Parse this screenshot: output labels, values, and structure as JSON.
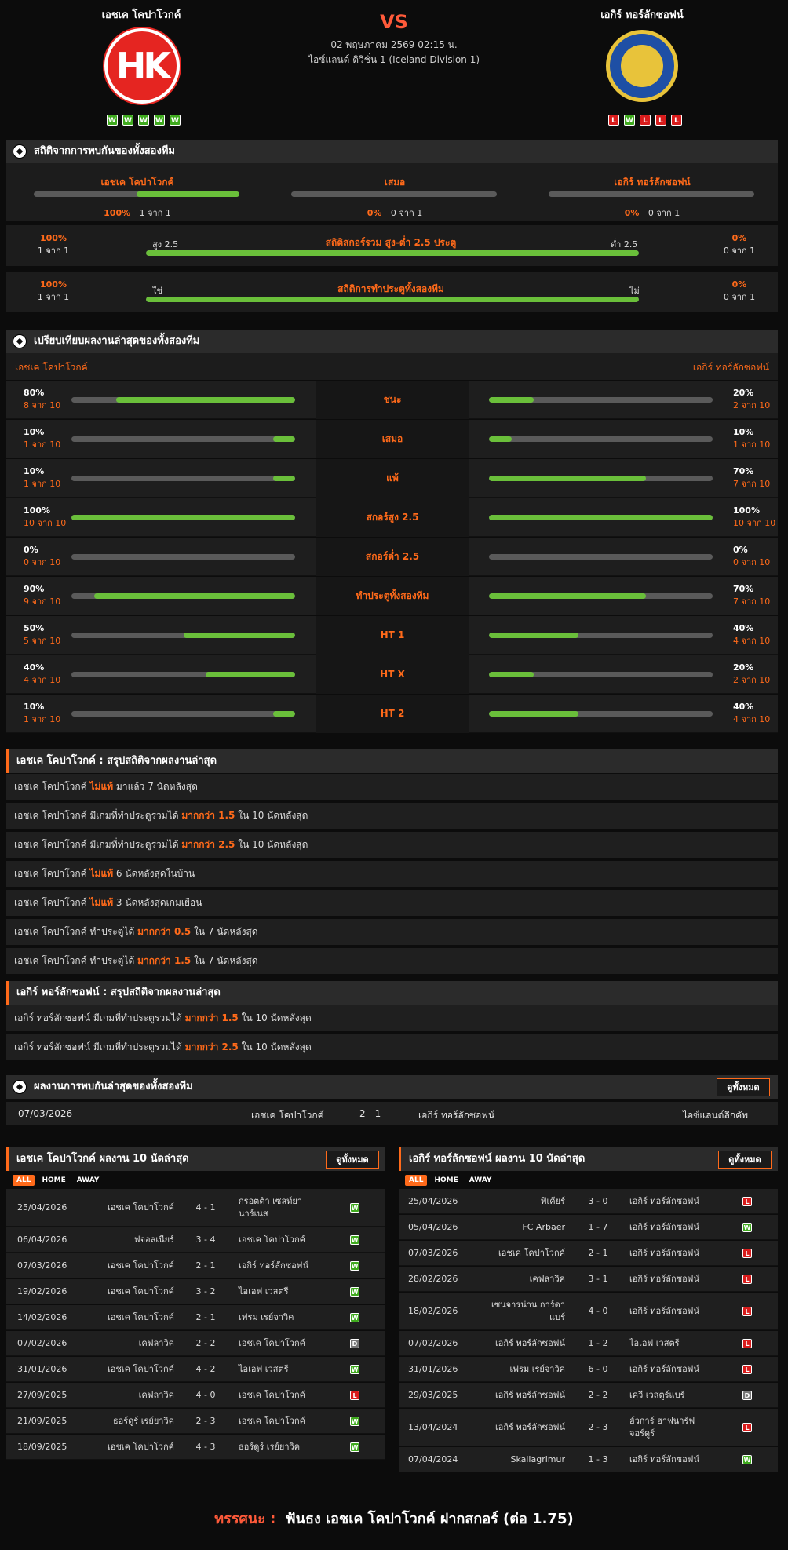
{
  "header": {
    "home": "เอชเค โคปาโวกค์",
    "away": "เอกิร์ ทอร์ลักซอฟน์",
    "vs": "VS",
    "datetime": "02 พฤษภาคม 2569 02:15 น.",
    "league": "ไอซ์แลนด์ ดิวิชั่น 1 (Iceland Division 1)",
    "home_logo_text": "HK",
    "home_form": [
      "W",
      "W",
      "W",
      "W",
      "W"
    ],
    "away_form": [
      "L",
      "W",
      "L",
      "L",
      "L"
    ]
  },
  "h2h": {
    "title": "สถิติจากการพบกันของทั้งสองทีม",
    "cols": [
      {
        "label": "เอชเค โคปาโวกค์",
        "pct": "100%",
        "count": "1 จาก 1",
        "fill": 1
      },
      {
        "label": "เสมอ",
        "pct": "0%",
        "count": "0 จาก 1",
        "fill": 0
      },
      {
        "label": "เอกิร์ ทอร์ลักซอฟน์",
        "pct": "0%",
        "count": "0 จาก 1",
        "fill": 0
      }
    ],
    "ou": {
      "title": "สถิติสกอร์รวม สูง-ต่ำ 2.5 ประตู",
      "left_label": "สูง 2.5",
      "right_label": "ต่ำ 2.5",
      "left_pct": "100%",
      "left_count": "1 จาก 1",
      "right_pct": "0%",
      "right_count": "0 จาก 1",
      "fill": 1
    },
    "btts": {
      "title": "สถิติการทำประตูทั้งสองทีม",
      "left_label": "ใช่",
      "right_label": "ไม่",
      "left_pct": "100%",
      "left_count": "1 จาก 1",
      "right_pct": "0%",
      "right_count": "0 จาก 1",
      "fill": 1
    }
  },
  "compare": {
    "title": "เปรียบเทียบผลงานล่าสุดของทั้งสองทีม",
    "home": "เอชเค โคปาโวกค์",
    "away": "เอกิร์ ทอร์ลักซอฟน์",
    "rows": [
      {
        "label": "ชนะ",
        "hp": "80%",
        "hc": "8 จาก 10",
        "hf": 0.8,
        "ap": "20%",
        "ac": "2 จาก 10",
        "af": 0.2
      },
      {
        "label": "เสมอ",
        "hp": "10%",
        "hc": "1 จาก 10",
        "hf": 0.1,
        "ap": "10%",
        "ac": "1 จาก 10",
        "af": 0.1
      },
      {
        "label": "แพ้",
        "hp": "10%",
        "hc": "1 จาก 10",
        "hf": 0.1,
        "ap": "70%",
        "ac": "7 จาก 10",
        "af": 0.7
      },
      {
        "label": "สกอร์สูง 2.5",
        "hp": "100%",
        "hc": "10 จาก 10",
        "hf": 1,
        "ap": "100%",
        "ac": "10 จาก 10",
        "af": 1
      },
      {
        "label": "สกอร์ต่ำ 2.5",
        "hp": "0%",
        "hc": "0 จาก 10",
        "hf": 0,
        "ap": "0%",
        "ac": "0 จาก 10",
        "af": 0
      },
      {
        "label": "ทำประตูทั้งสองทีม",
        "hp": "90%",
        "hc": "9 จาก 10",
        "hf": 0.9,
        "ap": "70%",
        "ac": "7 จาก 10",
        "af": 0.7
      },
      {
        "label": "HT 1",
        "hp": "50%",
        "hc": "5 จาก 10",
        "hf": 0.5,
        "ap": "40%",
        "ac": "4 จาก 10",
        "af": 0.4
      },
      {
        "label": "HT X",
        "hp": "40%",
        "hc": "4 จาก 10",
        "hf": 0.4,
        "ap": "20%",
        "ac": "2 จาก 10",
        "af": 0.2
      },
      {
        "label": "HT 2",
        "hp": "10%",
        "hc": "1 จาก 10",
        "hf": 0.1,
        "ap": "40%",
        "ac": "4 จาก 10",
        "af": 0.4
      }
    ]
  },
  "home_summary": {
    "title": "เอชเค โคปาโวกค์ : สรุปสถิติจากผลงานล่าสุด",
    "rows": [
      [
        "เอชเค โคปาโวกค์ ",
        "ไม่แพ้",
        " มาแล้ว 7 นัดหลังสุด"
      ],
      [
        "เอชเค โคปาโวกค์  มีเกมที่ทำประตูรวมได้ ",
        "มากกว่า 1.5",
        " ใน 10 นัดหลังสุด"
      ],
      [
        "เอชเค โคปาโวกค์  มีเกมที่ทำประตูรวมได้ ",
        "มากกว่า 2.5",
        " ใน 10 นัดหลังสุด"
      ],
      [
        "เอชเค โคปาโวกค์ ",
        "ไม่แพ้",
        " 6  นัดหลังสุดในบ้าน"
      ],
      [
        "เอชเค โคปาโวกค์ ",
        "ไม่แพ้",
        " 3  นัดหลังสุดเกมเยือน"
      ],
      [
        "เอชเค โคปาโวกค์  ทำประตูได้ ",
        "มากกว่า 0.5",
        " ใน 7 นัดหลังสุด"
      ],
      [
        "เอชเค โคปาโวกค์  ทำประตูได้ ",
        "มากกว่า 1.5",
        " ใน 7 นัดหลังสุด"
      ]
    ]
  },
  "away_summary": {
    "title": "เอกิร์ ทอร์ลักซอฟน์ : สรุปสถิติจากผลงานล่าสุด",
    "rows": [
      [
        "เอกิร์ ทอร์ลักซอฟน์  มีเกมที่ทำประตูรวมได้ ",
        "มากกว่า 1.5",
        " ใน 10 นัดหลังสุด"
      ],
      [
        "เอกิร์ ทอร์ลักซอฟน์  มีเกมที่ทำประตูรวมได้ ",
        "มากกว่า 2.5",
        " ใน 10 นัดหลังสุด"
      ]
    ]
  },
  "last_meet": {
    "title": "ผลงานการพบกันล่าสุดของทั้งสองทีม",
    "view_all": "ดูทั้งหมด",
    "date": "07/03/2026",
    "home": "เอชเค โคปาโวกค์",
    "score": "2 - 1",
    "away": "เอกิร์ ทอร์ลักซอฟน์",
    "comp": "ไอซ์แลนด์ลีกคัพ"
  },
  "home_last10": {
    "title": "เอชเค โคปาโวกค์ ผลงาน 10 นัดล่าสุด",
    "view_all": "ดูทั้งหมด",
    "tabs": [
      "ALL",
      "HOME",
      "AWAY"
    ],
    "rows": [
      [
        "25/04/2026",
        "เอชเค โคปาโวกค์",
        "4 - 1",
        "กรอตต้า เซลท์ยา\nนาร์เนส",
        "W"
      ],
      [
        "06/04/2026",
        "ฟจอลเนียร์",
        "3 - 4",
        "เอชเค โคปาโวกค์",
        "W"
      ],
      [
        "07/03/2026",
        "เอชเค โคปาโวกค์",
        "2 - 1",
        "เอกิร์ ทอร์ลักซอฟน์",
        "W"
      ],
      [
        "19/02/2026",
        "เอชเค โคปาโวกค์",
        "3 - 2",
        "ไอเอฟ เวสตรี",
        "W"
      ],
      [
        "14/02/2026",
        "เอชเค โคปาโวกค์",
        "2 - 1",
        "เฟรม เรย์จาวิค",
        "W"
      ],
      [
        "07/02/2026",
        "เคฟลาวิค",
        "2 - 2",
        "เอชเค โคปาโวกค์",
        "D"
      ],
      [
        "31/01/2026",
        "เอชเค โคปาโวกค์",
        "4 - 2",
        "ไอเอฟ เวสตรี",
        "W"
      ],
      [
        "27/09/2025",
        "เคฟลาวิค",
        "4 - 0",
        "เอชเค โคปาโวกค์",
        "L"
      ],
      [
        "21/09/2025",
        "ธอร์ดูร์ เรย์ยาวิค",
        "2 - 3",
        "เอชเค โคปาโวกค์",
        "W"
      ],
      [
        "18/09/2025",
        "เอชเค โคปาโวกค์",
        "4 - 3",
        "ธอร์ดูร์ เรย์ยาวิค",
        "W"
      ]
    ]
  },
  "away_last10": {
    "title": "เอกิร์ ทอร์ลักซอฟน์ ผลงาน 10 นัดล่าสุด",
    "view_all": "ดูทั้งหมด",
    "tabs": [
      "ALL",
      "HOME",
      "AWAY"
    ],
    "rows": [
      [
        "25/04/2026",
        "ฟิเคียร์",
        "3 - 0",
        "เอกิร์ ทอร์ลักซอฟน์",
        "L"
      ],
      [
        "05/04/2026",
        "FC Arbaer",
        "1 - 7",
        "เอกิร์ ทอร์ลักซอฟน์",
        "W"
      ],
      [
        "07/03/2026",
        "เอชเค โคปาโวกค์",
        "2 - 1",
        "เอกิร์ ทอร์ลักซอฟน์",
        "L"
      ],
      [
        "28/02/2026",
        "เคฟลาวิค",
        "3 - 1",
        "เอกิร์ ทอร์ลักซอฟน์",
        "L"
      ],
      [
        "18/02/2026",
        "เซนจารน่าน การ์ดา\nแบร์",
        "4 - 0",
        "เอกิร์ ทอร์ลักซอฟน์",
        "L"
      ],
      [
        "07/02/2026",
        "เอกิร์ ทอร์ลักซอฟน์",
        "1 - 2",
        "ไอเอฟ เวสตรี",
        "L"
      ],
      [
        "31/01/2026",
        "เฟรม เรย์จาวิค",
        "6 - 0",
        "เอกิร์ ทอร์ลักซอฟน์",
        "L"
      ],
      [
        "29/03/2025",
        "เอกิร์ ทอร์ลักซอฟน์",
        "2 - 2",
        "เควี เวสตูร์แบร์",
        "D"
      ],
      [
        "13/04/2024",
        "เอกิร์ ทอร์ลักซอฟน์",
        "2 - 3",
        "ฮ์วการ์ ฮาฟนาร์ฟ\nจอร์ดูร์",
        "L"
      ],
      [
        "07/04/2024",
        "Skallagrimur",
        "1 - 3",
        "เอกิร์ ทอร์ลักซอฟน์",
        "W"
      ]
    ]
  },
  "verdict": {
    "label": "ทรรศนะ :",
    "text": "ฟันธง เอชเค โคปาโวกค์ ฝากสกอร์ (ต่อ 1.75)"
  }
}
